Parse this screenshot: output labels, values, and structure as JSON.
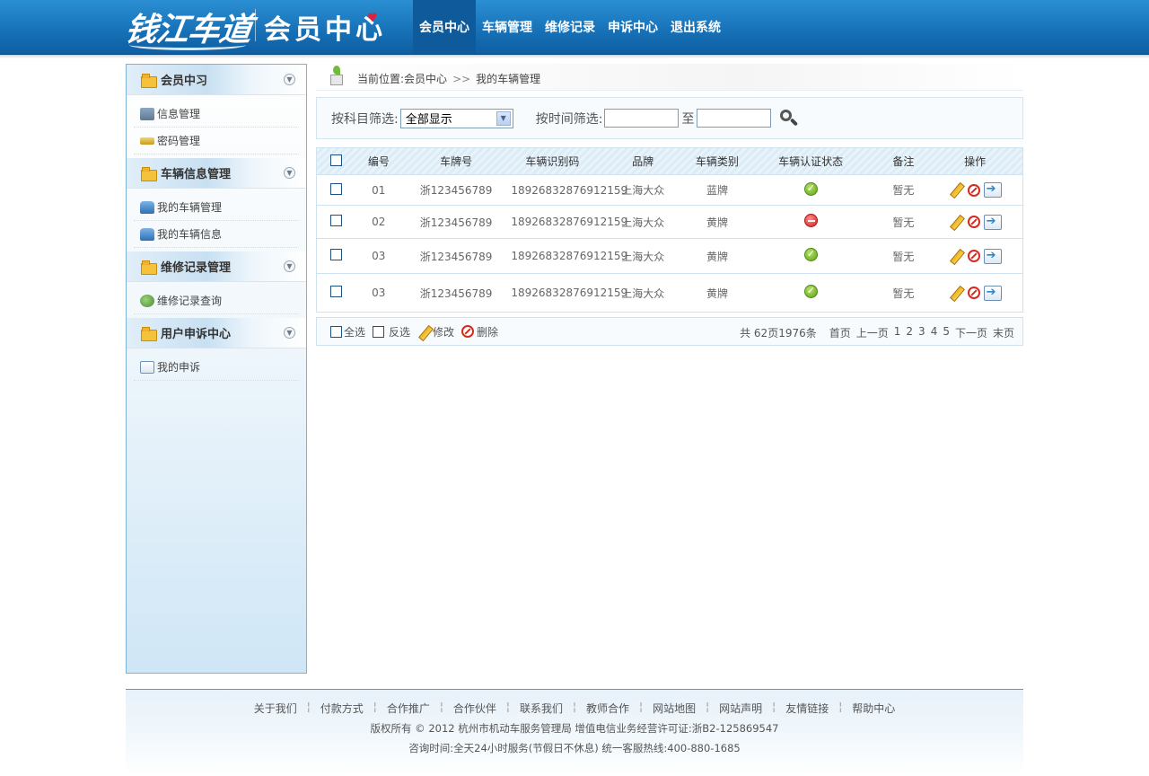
{
  "header": {
    "logo_script": "钱江车道",
    "logo_title": "会员中心",
    "nav": [
      {
        "label": "会员中心",
        "active": true
      },
      {
        "label": "车辆管理",
        "active": false
      },
      {
        "label": "维修记录",
        "active": false
      },
      {
        "label": "申诉中心",
        "active": false
      },
      {
        "label": "退出系统",
        "active": false
      }
    ]
  },
  "sidebar": {
    "sections": [
      {
        "title": "会员中习",
        "items": [
          "信息管理",
          "密码管理"
        ]
      },
      {
        "title": "车辆信息管理",
        "items": [
          "我的车辆管理",
          "我的车辆信息"
        ]
      },
      {
        "title": "维修记录管理",
        "items": [
          "维修记录查询"
        ]
      },
      {
        "title": "用户申诉中心",
        "items": [
          "我的申诉"
        ]
      }
    ]
  },
  "breadcrumb": {
    "prefix": "当前位置:",
    "root": "会员中心",
    "arrow": ">>",
    "current": "我的车辆管理"
  },
  "filter": {
    "subject_label": "按科目筛选:",
    "subject_value": "全部显示",
    "time_label": "按时间筛选:",
    "from_value": "",
    "to_label": "至",
    "to_value": ""
  },
  "table": {
    "headers": [
      "编号",
      "车牌号",
      "车辆识别码",
      "品牌",
      "车辆类别",
      "车辆认证状态",
      "备注",
      "操作"
    ],
    "rows": [
      {
        "no": "01",
        "plate": "浙123456789",
        "vin": "18926832876912159",
        "brand": "上海大众",
        "type": "蓝牌",
        "status": "verified",
        "note": "暂无"
      },
      {
        "no": "02",
        "plate": "浙123456789",
        "vin": "18926832876912159",
        "brand": "上海大众",
        "type": "黄牌",
        "status": "rejected",
        "note": "暂无"
      },
      {
        "no": "03",
        "plate": "浙123456789",
        "vin": "18926832876912159",
        "brand": "上海大众",
        "type": "黄牌",
        "status": "verified",
        "note": "暂无"
      },
      {
        "no": "03",
        "plate": "浙123456789",
        "vin": "18926832876912159",
        "brand": "上海大众",
        "type": "黄牌",
        "status": "verified",
        "note": "暂无"
      }
    ]
  },
  "pager": {
    "select_all": "全选",
    "invert": "反选",
    "edit": "修改",
    "delete": "删除",
    "summary": "共 62页1976条",
    "first": "首页",
    "prev": "上一页",
    "pages": [
      "1",
      "2",
      "3",
      "4",
      "5"
    ],
    "next": "下一页",
    "last": "末页"
  },
  "footer": {
    "links": [
      "关于我们",
      "付款方式",
      "合作推广",
      "合作伙伴",
      "联系我们",
      "教师合作",
      "网站地图",
      "网站声明",
      "友情链接",
      "帮助中心"
    ],
    "copyright": "版权所有 © 2012 杭州市机动车服务管理局 增值电信业务经营许可证:浙B2-125869547",
    "contact": "咨询时间:全天24小时服务(节假日不休息) 统一客服热线:400-880-1685"
  },
  "colors": {
    "header_blue": "#1670b6",
    "nav_active": "#0e5a9b",
    "sidebar_border": "#7fb3d6",
    "status_ok": "#5c9f17",
    "status_no": "#d0201e"
  },
  "icons": {
    "section": "folder-icon",
    "collapse": "chevron-down-icon",
    "status_verified": "check-circle-icon",
    "status_rejected": "minus-circle-icon",
    "search": "search-icon",
    "edit": "pencil-icon",
    "delete": "forbid-icon",
    "view": "arrow-right-icon"
  }
}
